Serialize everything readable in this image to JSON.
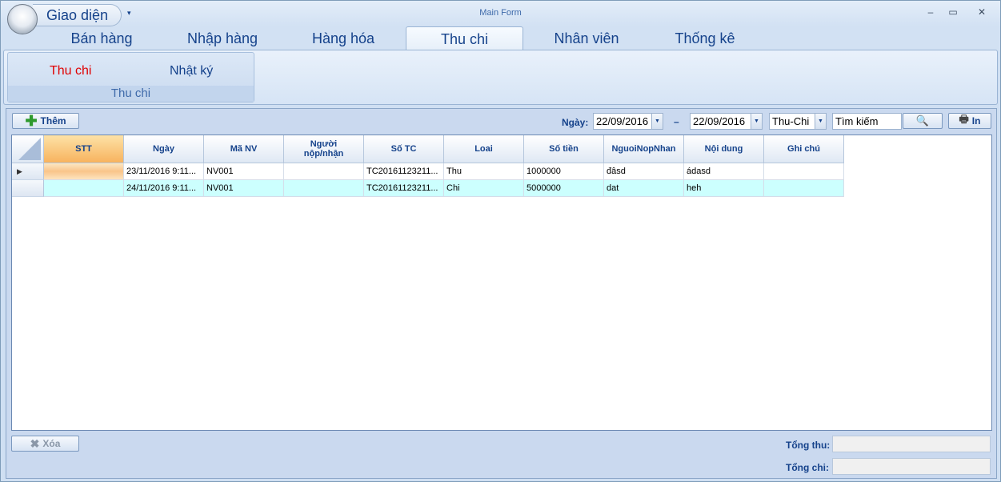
{
  "window": {
    "app_menu_label": "Giao diện",
    "title": "Main Form",
    "minimize": "–",
    "maximize": "▭",
    "close": "✕"
  },
  "tabs": [
    {
      "label": "Bán hàng"
    },
    {
      "label": "Nhập hàng"
    },
    {
      "label": "Hàng hóa"
    },
    {
      "label": "Thu chi",
      "active": true
    },
    {
      "label": "Nhân viên"
    },
    {
      "label": "Thống kê"
    }
  ],
  "ribbon": {
    "group_label": "Thu chi",
    "buttons": [
      {
        "label": "Thu chi",
        "color": "#e00000"
      },
      {
        "label": "Nhật ký",
        "color": "#15428b"
      }
    ]
  },
  "toolbar": {
    "add_label": "Thêm",
    "date_label": "Ngày:",
    "date_from": "22/09/2016",
    "date_sep": "–",
    "date_to": "22/09/2016",
    "type_value": "Thu-Chi",
    "search_value": "Tìm kiếm",
    "print_label": "In"
  },
  "grid": {
    "columns": [
      "STT",
      "Ngày",
      "Mã NV",
      "Người\nnộp/nhận",
      "Số TC",
      "Loai",
      "Số tiền",
      "NguoiNopNhan",
      "Nội dung",
      "Ghi chú"
    ],
    "rows": [
      {
        "stt": "",
        "ngay": "23/11/2016 9:11...",
        "ma_nv": "NV001",
        "nguoi": "",
        "so_tc": "TC20161123211...",
        "loai": "Thu",
        "so_tien": "1000000",
        "nguoinopnhan": "đâsd",
        "noi_dung": "ádasd",
        "ghi_chu": ""
      },
      {
        "stt": "",
        "ngay": "24/11/2016 9:11...",
        "ma_nv": "NV001",
        "nguoi": "",
        "so_tc": "TC20161123211...",
        "loai": "Chi",
        "so_tien": "5000000",
        "nguoinopnhan": "dat",
        "noi_dung": "heh",
        "ghi_chu": ""
      }
    ]
  },
  "footer": {
    "delete_label": "Xóa",
    "total_in_label": "Tổng thu:",
    "total_in_value": "",
    "total_out_label": "Tổng chi:",
    "total_out_value": ""
  }
}
